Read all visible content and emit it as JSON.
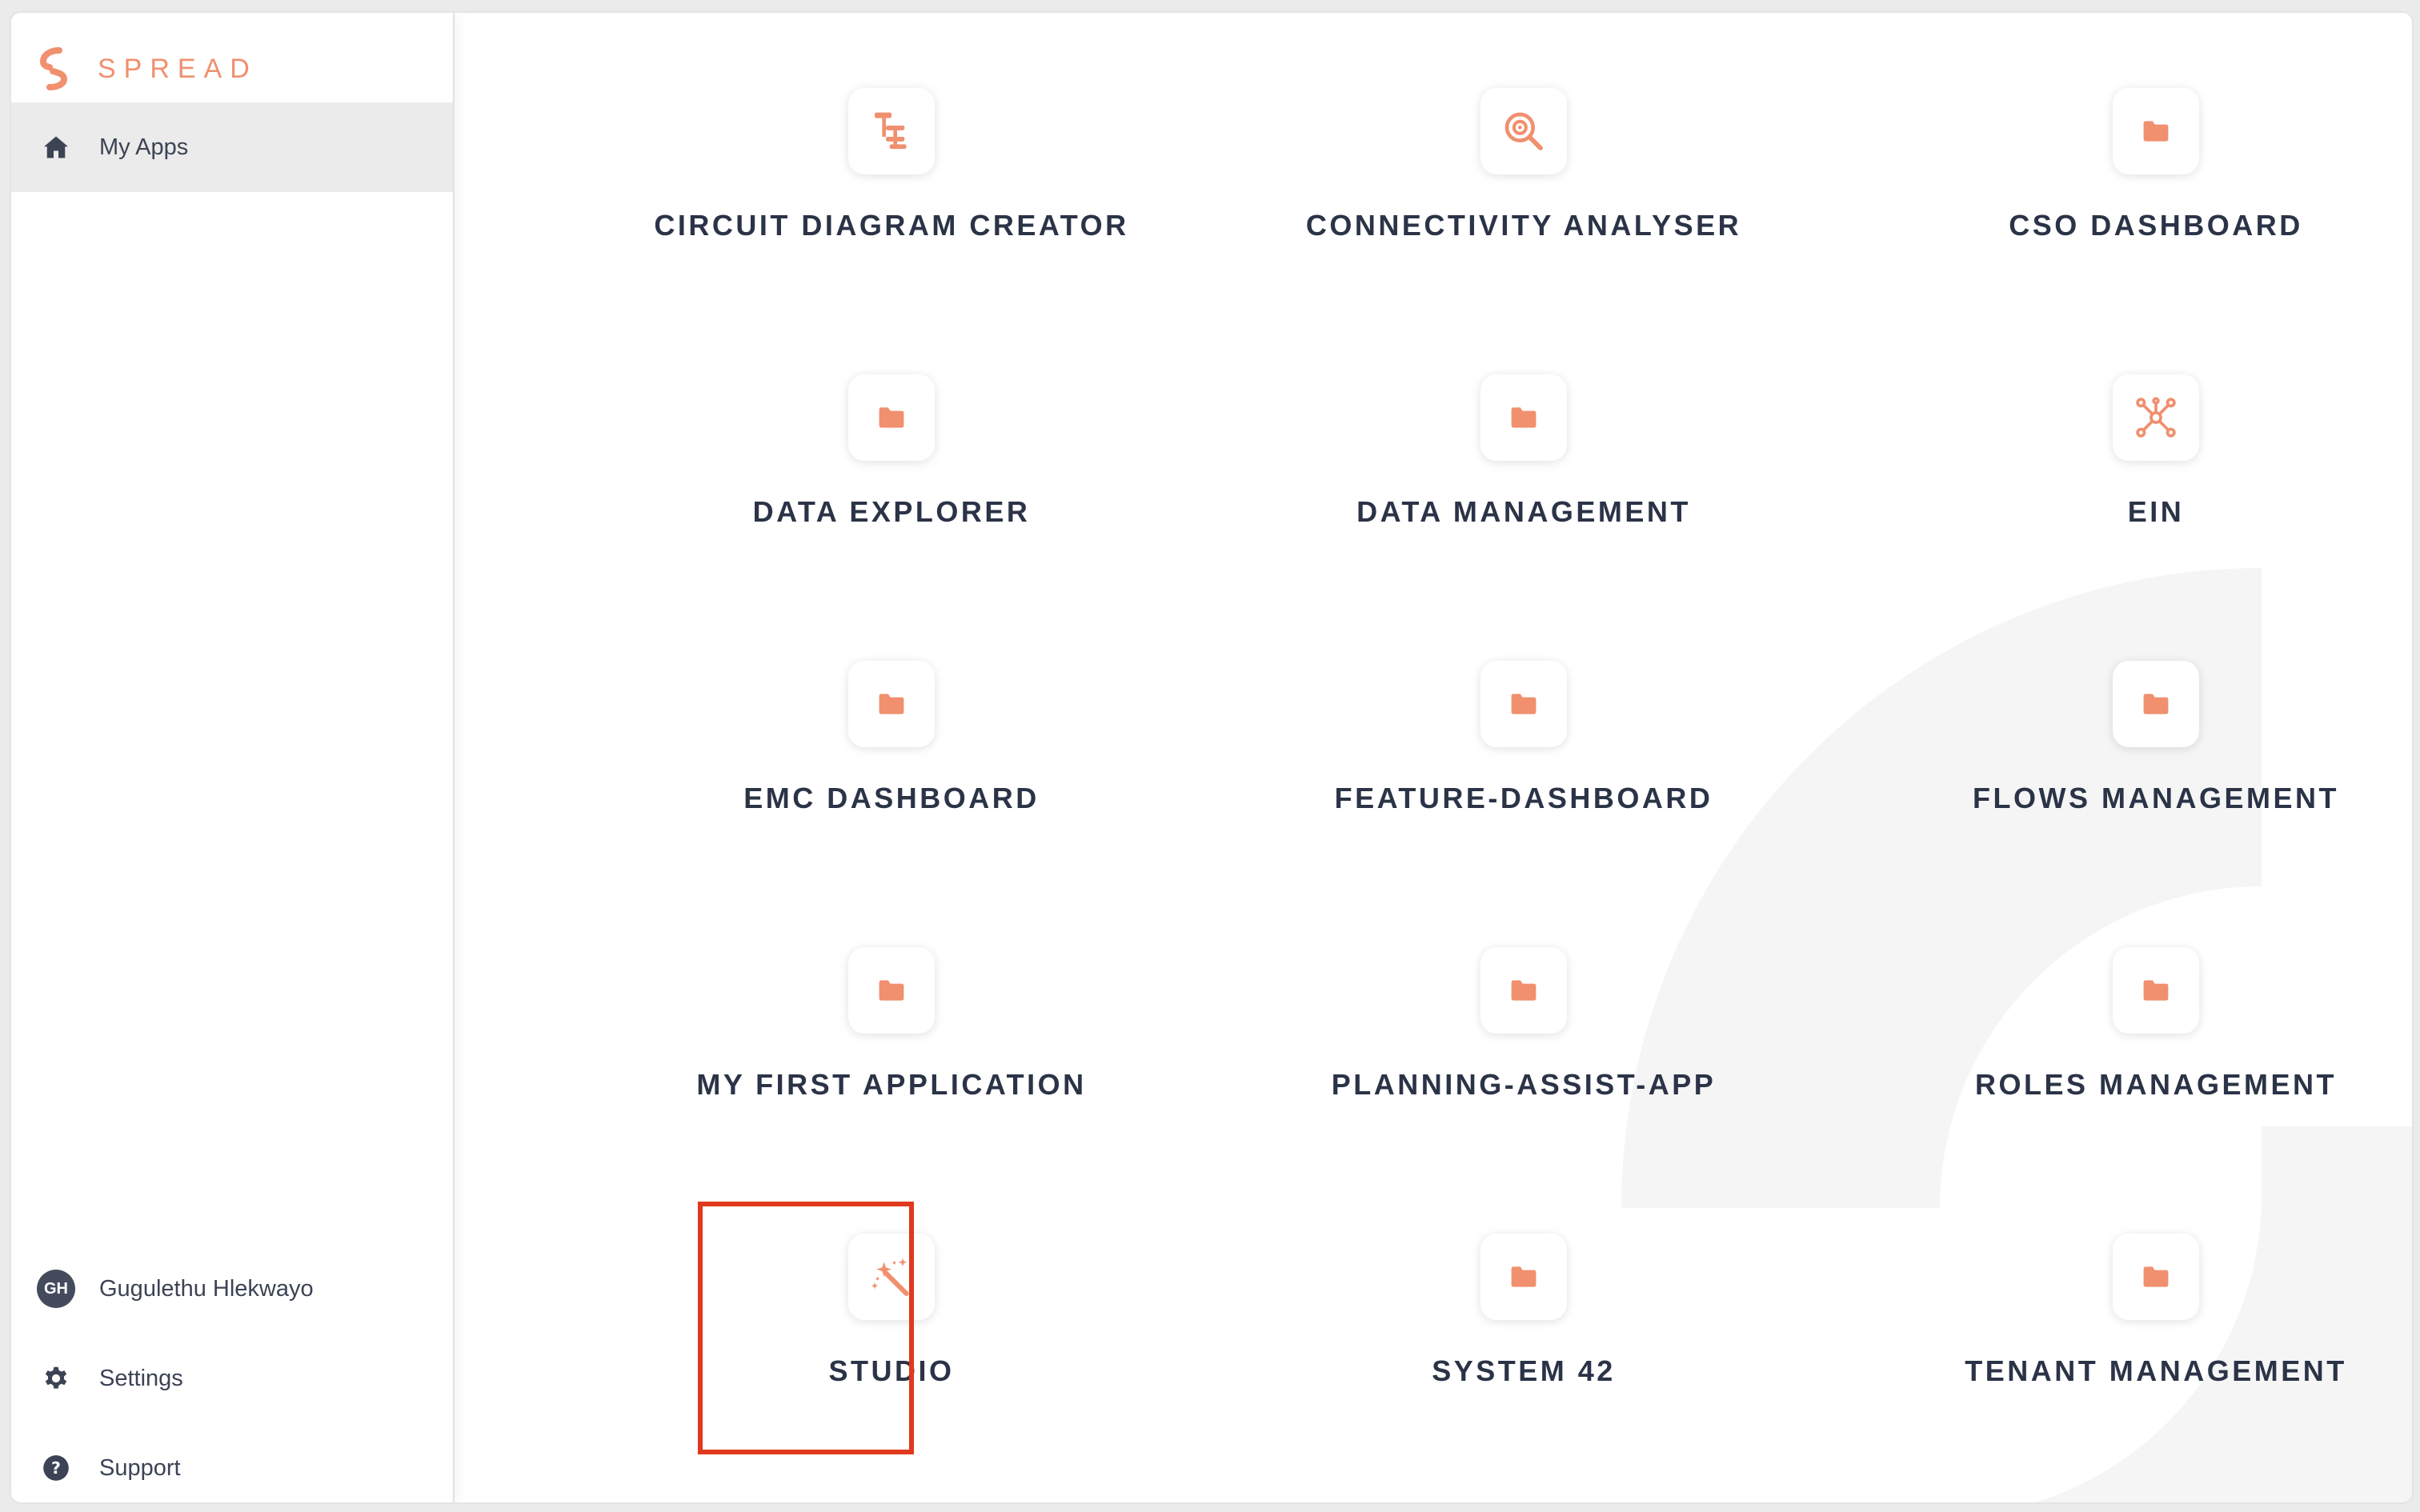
{
  "brand": {
    "name": "SPREAD",
    "accent_color": "#f0906f",
    "logo_icon": "spread-logo-icon"
  },
  "sidebar": {
    "nav": {
      "label": "My Apps",
      "icon": "home-icon"
    },
    "user": {
      "initials": "GH",
      "name": "Gugulethu Hlekwayo"
    },
    "settings": {
      "label": "Settings",
      "icon": "gear-icon"
    },
    "support": {
      "label": "Support",
      "icon": "help-circle-icon"
    }
  },
  "apps": [
    {
      "label": "CIRCUIT DIAGRAM CREATOR",
      "icon": "circuit-diagram-icon"
    },
    {
      "label": "CONNECTIVITY ANALYSER",
      "icon": "magnify-gear-icon"
    },
    {
      "label": "CSO DASHBOARD",
      "icon": "folder-icon"
    },
    {
      "label": "DATA EXPLORER",
      "icon": "folder-icon"
    },
    {
      "label": "DATA MANAGEMENT",
      "icon": "folder-icon"
    },
    {
      "label": "EIN",
      "icon": "network-icon"
    },
    {
      "label": "EMC DASHBOARD",
      "icon": "folder-icon"
    },
    {
      "label": "FEATURE-DASHBOARD",
      "icon": "folder-icon"
    },
    {
      "label": "FLOWS MANAGEMENT",
      "icon": "folder-icon"
    },
    {
      "label": "MY FIRST APPLICATION",
      "icon": "folder-icon"
    },
    {
      "label": "PLANNING-ASSIST-APP",
      "icon": "folder-icon"
    },
    {
      "label": "ROLES MANAGEMENT",
      "icon": "folder-icon"
    },
    {
      "label": "STUDIO",
      "icon": "magic-wand-icon"
    },
    {
      "label": "SYSTEM 42",
      "icon": "folder-icon"
    },
    {
      "label": "TENANT MANAGEMENT",
      "icon": "folder-icon"
    }
  ],
  "highlight_color": "#e0391f"
}
